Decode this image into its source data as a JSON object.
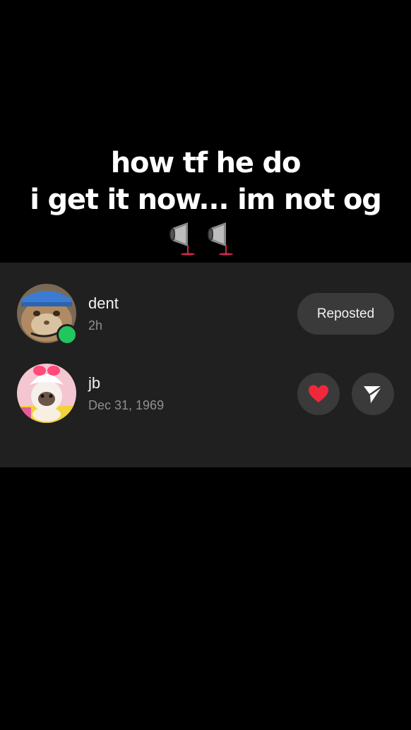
{
  "caption": {
    "line1": "how tf he do",
    "line2": "i get it now... im not og",
    "emojis": [
      "cup-icon",
      "cup-icon"
    ]
  },
  "items": [
    {
      "username": "dent",
      "meta": "2h",
      "online": true,
      "action_label": "Reposted"
    },
    {
      "username": "jb",
      "meta": "Dec 31, 1969",
      "actions": [
        "heart-icon",
        "send-icon"
      ]
    }
  ],
  "colors": {
    "background": "#000000",
    "panel": "#202020",
    "button": "#3a3a3a",
    "online": "#22c55e",
    "heart": "#f0283c",
    "meta_text": "#8f8f8f"
  }
}
